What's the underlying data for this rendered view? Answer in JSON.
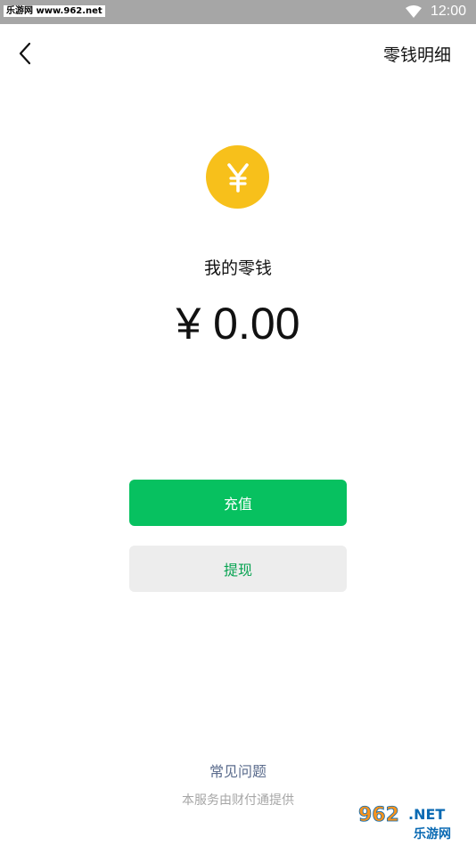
{
  "status_bar": {
    "watermark": "乐游网 www.962.net",
    "time": "12:00"
  },
  "header": {
    "detail_link": "零钱明细"
  },
  "wallet": {
    "currency_symbol": "¥",
    "label": "我的零钱",
    "amount": "¥ 0.00"
  },
  "actions": {
    "recharge_label": "充值",
    "withdraw_label": "提现"
  },
  "footer": {
    "faq_label": "常见问题",
    "provider_text": "本服务由财付通提供"
  },
  "corner_logo": {
    "top_text": "962.NET",
    "bottom_text": "乐游网"
  },
  "colors": {
    "primary_green": "#07c160",
    "coin_yellow": "#f7c01b",
    "status_bar": "#a6a6a6"
  }
}
